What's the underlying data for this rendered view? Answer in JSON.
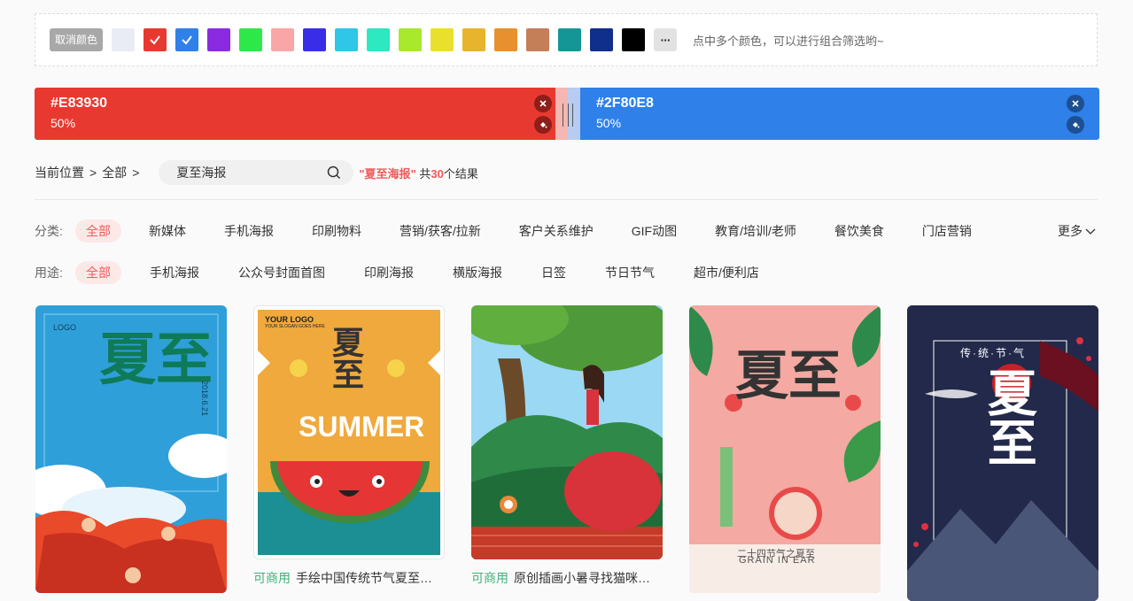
{
  "color_filter": {
    "cancel_label": "取消颜色",
    "swatches": [
      {
        "color": "#e9ecf4",
        "checked": false
      },
      {
        "color": "#e83930",
        "checked": true
      },
      {
        "color": "#2f80e8",
        "checked": true
      },
      {
        "color": "#8a2be2",
        "checked": false
      },
      {
        "color": "#2ee84a",
        "checked": false
      },
      {
        "color": "#fba6a6",
        "checked": false
      },
      {
        "color": "#3a2de8",
        "checked": false
      },
      {
        "color": "#2fc6e8",
        "checked": false
      },
      {
        "color": "#2de8c0",
        "checked": false
      },
      {
        "color": "#a8e82d",
        "checked": false
      },
      {
        "color": "#e8e02d",
        "checked": false
      },
      {
        "color": "#e8b42d",
        "checked": false
      },
      {
        "color": "#e8902d",
        "checked": false
      },
      {
        "color": "#c47e58",
        "checked": false
      },
      {
        "color": "#159696",
        "checked": false
      },
      {
        "color": "#102e8c",
        "checked": false
      },
      {
        "color": "#000000",
        "checked": false
      }
    ],
    "more_label": "···",
    "hint": "点中多个颜色，可以进行组合筛选哟~"
  },
  "selected_colors": [
    {
      "hex": "#E83930",
      "percent": "50%"
    },
    {
      "hex": "#2F80E8",
      "percent": "50%"
    }
  ],
  "breadcrumb": {
    "prefix": "当前位置",
    "sep": ">",
    "item": "全部",
    "sep2": ">"
  },
  "search": {
    "value": "夏至海报"
  },
  "result": {
    "open_quote": "\"",
    "keyword": "夏至海报",
    "close_quote": "\"",
    "pre": " 共",
    "count": "30",
    "post": "个结果"
  },
  "category": {
    "label": "分类:",
    "items": [
      "全部",
      "新媒体",
      "手机海报",
      "印刷物料",
      "营销/获客/拉新",
      "客户关系维护",
      "GIF动图",
      "教育/培训/老师",
      "餐饮美食",
      "门店营销"
    ],
    "more": "更多"
  },
  "usage": {
    "label": "用途:",
    "items": [
      "全部",
      "手机海报",
      "公众号封面首图",
      "印刷海报",
      "横版海报",
      "日签",
      "节日节气",
      "超市/便利店"
    ]
  },
  "cards": [
    {
      "poster_text": "夏至",
      "small_text": "LOGO",
      "date": "2018.6.21"
    },
    {
      "tag": "可商用",
      "title": "手绘中国传统节气夏至…",
      "poster_text": "夏至",
      "logo_text": "YOUR LOGO",
      "slogan": "YOUR SLOGAN GOES HERE",
      "summer": "SUMMER"
    },
    {
      "tag": "可商用",
      "title": "原创插画小暑寻找猫咪…"
    },
    {
      "poster_text": "夏至",
      "watermark": "GRAIN IN EAR",
      "footer": "二十四节气之夏至"
    },
    {
      "poster_text": "夏至",
      "header": "传·统·节·气"
    }
  ]
}
